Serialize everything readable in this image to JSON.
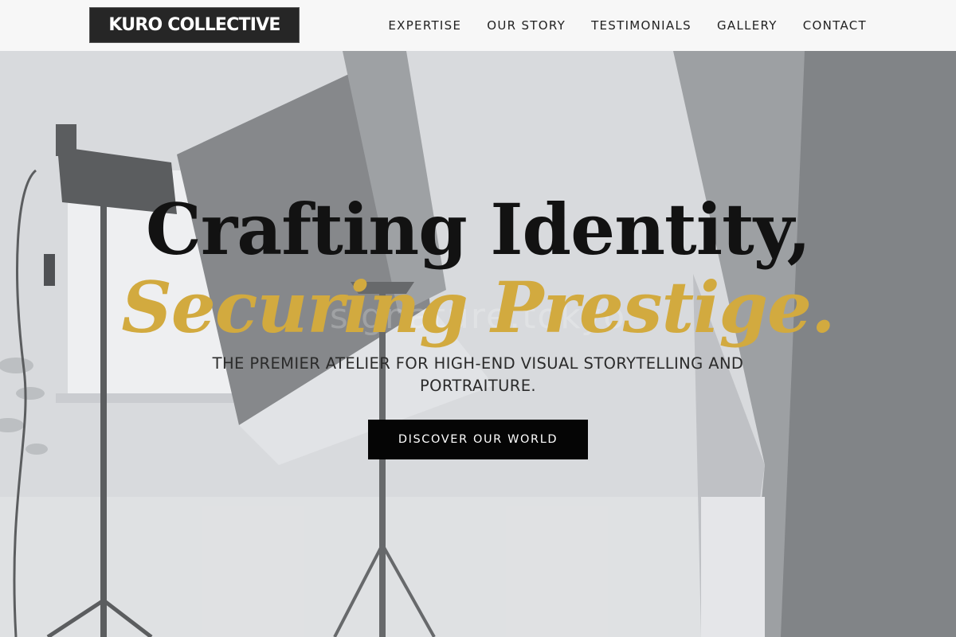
{
  "brand": {
    "name": "KURO COLLECTIVE"
  },
  "nav": {
    "items": [
      {
        "label": "EXPERTISE"
      },
      {
        "label": "OUR STORY"
      },
      {
        "label": "TESTIMONIALS"
      },
      {
        "label": "GALLERY"
      },
      {
        "label": "CONTACT"
      }
    ]
  },
  "hero": {
    "headline": "Crafting Identity,",
    "headline_accent": "Securing Prestige.",
    "watermark": "signature.tokyo",
    "subtitle": "THE PREMIER ATELIER FOR HIGH-END VISUAL STORYTELLING AND PORTRAITURE.",
    "cta_label": "DISCOVER OUR WORLD"
  },
  "colors": {
    "accent_gold": "#d2aa3f",
    "header_bg": "#f7f7f7",
    "cta_bg": "#050505",
    "logo_bg": "#262626"
  }
}
